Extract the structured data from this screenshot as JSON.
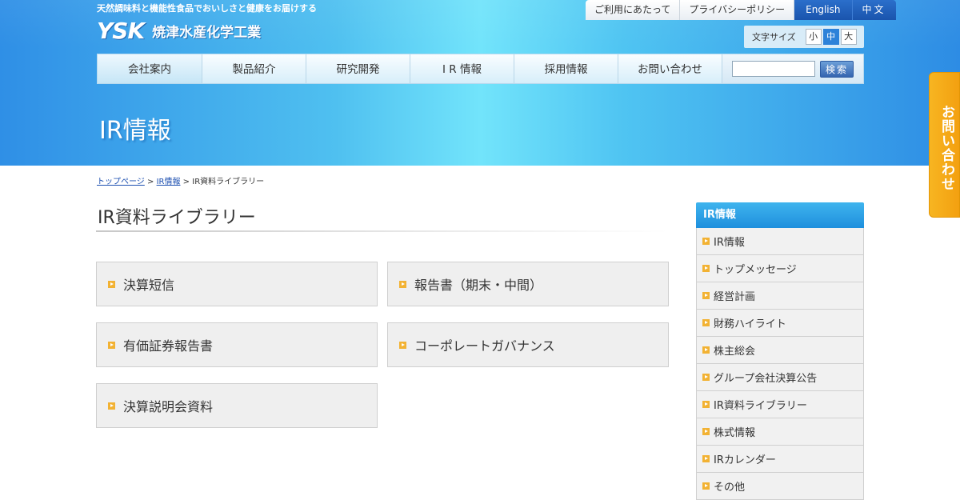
{
  "header": {
    "tagline": "天然調味料と機能性食品でおいしさと健康をお届けする",
    "logo_mark": "YSK",
    "logo_name": "焼津水産化学工業",
    "util_links": [
      "ご利用にあたって",
      "プライバシーポリシー",
      "English",
      "中文"
    ],
    "fontsize_label": "文字サイズ",
    "fontsize_options": [
      "小",
      "中",
      "大"
    ],
    "fontsize_selected": "中",
    "nav": [
      "会社案内",
      "製品紹介",
      "研究開発",
      "I R 情報",
      "採用情報",
      "お問い合わせ"
    ],
    "search_value": "",
    "search_button": "検索",
    "page_title": "IR情報"
  },
  "side_tab": {
    "label": "お問い合わせ"
  },
  "breadcrumb": {
    "home": "トップページ",
    "ir": "IR情報",
    "current": "IR資料ライブラリー",
    "sep": ">"
  },
  "main": {
    "heading": "IR資料ライブラリー",
    "cards": [
      "決算短信",
      "報告書（期末・中間）",
      "有価証券報告書",
      "コーポレートガバナンス",
      "決算説明会資料"
    ]
  },
  "sidebar": {
    "title": "IR情報",
    "items": [
      "IR情報",
      "トップメッセージ",
      "経営計画",
      "財務ハイライト",
      "株主総会",
      "グループ会社決算公告",
      "IR資料ライブラリー",
      "株式情報",
      "IRカレンダー",
      "その他"
    ]
  },
  "colors": {
    "accent_blue": "#1e8fdd",
    "bullet_orange": "#f2b233",
    "tab_orange": "#f3a010"
  }
}
